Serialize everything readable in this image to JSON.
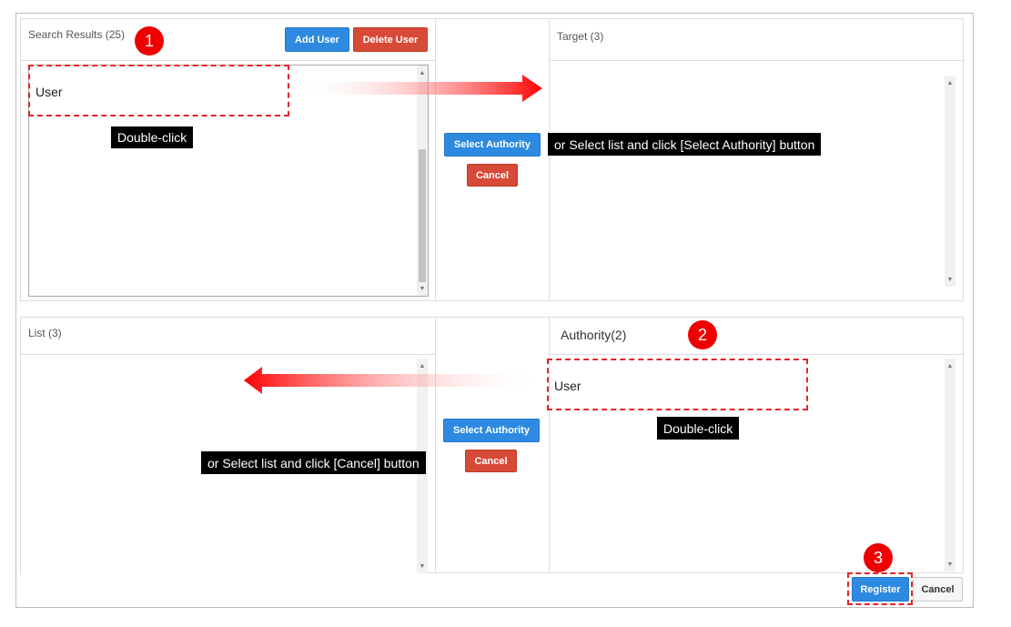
{
  "search_panel": {
    "title": "Search Results (25)",
    "add_user": "Add User",
    "delete_user": "Delete User",
    "item": "User"
  },
  "target_panel": {
    "title": "Target (3)"
  },
  "list_panel": {
    "title": "List (3)"
  },
  "authority_panel": {
    "title": "Authority(2)",
    "item": "User"
  },
  "middle_top": {
    "select_authority": "Select Authority",
    "cancel": "Cancel"
  },
  "middle_bottom": {
    "select_authority": "Select Authority",
    "cancel": "Cancel"
  },
  "annotations": {
    "badge1": "1",
    "badge2": "2",
    "badge3": "3",
    "tip_double_click_1": "Double-click",
    "tip_select_authority": "or Select list and click [Select Authority] button",
    "tip_double_click_2": "Double-click",
    "tip_cancel": "or Select list and click [Cancel] button"
  },
  "footer": {
    "register": "Register",
    "cancel": "Cancel"
  },
  "colors": {
    "primary": "#2d8ae0",
    "danger": "#d84a38",
    "annotation_red": "#ee0000"
  }
}
